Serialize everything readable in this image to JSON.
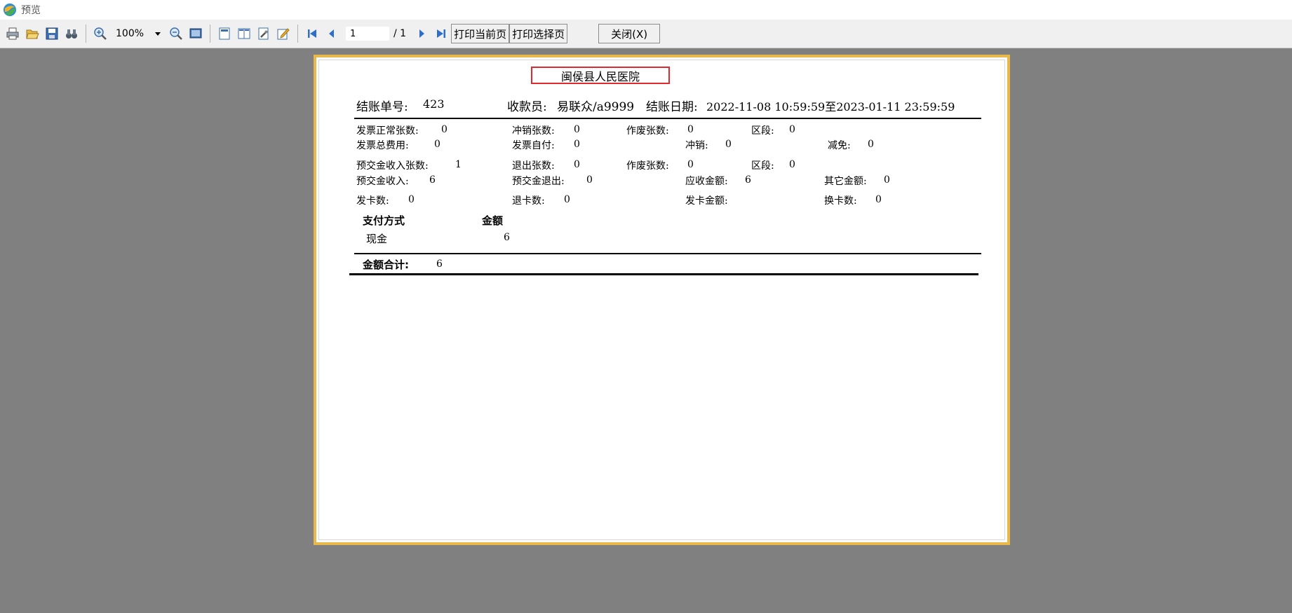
{
  "window": {
    "title": "预览"
  },
  "toolbar": {
    "zoom": "100%",
    "page_current": "1",
    "page_total": "/ 1",
    "print_current_label": "打印当前页",
    "print_selected_label": "打印选择页",
    "close_label": "关闭(X)"
  },
  "report": {
    "hospital": "闽侯县人民医院",
    "bill_no_label": "结账单号:",
    "bill_no": "423",
    "cashier_label": "收款员:",
    "cashier": "易联众/a9999",
    "date_label": "结账日期:",
    "date_range": "2022-11-08 10:59:59至2023-01-11 23:59:59",
    "rows": {
      "inv_normal_label": "发票正常张数:",
      "inv_normal": "0",
      "offset_count_label": "冲销张数:",
      "offset_count": "0",
      "void_count_label": "作废张数:",
      "void_count": "0",
      "segment_label": "区段:",
      "segment": "0",
      "inv_total_label": "发票总费用:",
      "inv_total": "0",
      "inv_self_label": "发票自付:",
      "inv_self": "0",
      "offset_label": "冲销:",
      "offset": "0",
      "reduce_label": "减免:",
      "reduce": "0",
      "prepay_count_label": "预交金收入张数:",
      "prepay_count": "1",
      "refund_count_label": "退出张数:",
      "refund_count": "0",
      "void_count2_label": "作废张数:",
      "void_count2": "0",
      "segment2_label": "区段:",
      "segment2": "0",
      "prepay_in_label": "预交金收入:",
      "prepay_in": "6",
      "prepay_out_label": "预交金退出:",
      "prepay_out": "0",
      "receivable_label": "应收金额:",
      "receivable": "6",
      "other_label": "其它金额:",
      "other": "0",
      "card_issue_label": "发卡数:",
      "card_issue": "0",
      "card_return_label": "退卡数:",
      "card_return": "0",
      "card_amount_label": "发卡金额:",
      "card_change_label": "换卡数:",
      "card_change": "0"
    },
    "payment": {
      "col_method": "支付方式",
      "col_amount": "金额",
      "method": "现金",
      "amount": "6"
    },
    "total_label": "金额合计:",
    "total": "6"
  },
  "colors": {
    "frame": "#e8b84a",
    "highlight": "#e0282e",
    "background": "#808080"
  }
}
